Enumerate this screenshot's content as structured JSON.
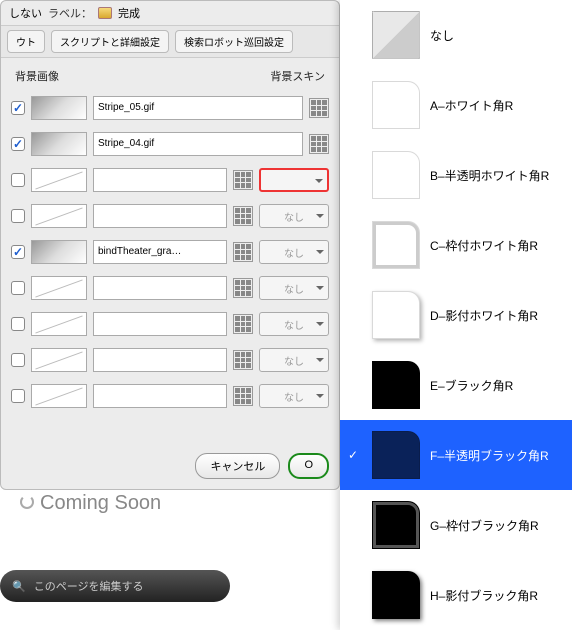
{
  "header": {
    "label_prefix": "ラベル：",
    "done_label": "完成",
    "not_label": "しない"
  },
  "tabs": [
    "ウト",
    "スクリプトと詳細設定",
    "検索ロボット巡回設定"
  ],
  "sections": {
    "left": "背景画像",
    "right": "背景スキン"
  },
  "rows": [
    {
      "checked": true,
      "swatch": "grad",
      "name": "Stripe_05.gif",
      "skin": "",
      "highlight": false
    },
    {
      "checked": true,
      "swatch": "grad",
      "name": "Stripe_04.gif",
      "skin": "",
      "highlight": false
    },
    {
      "checked": false,
      "swatch": "empty",
      "name": "",
      "skin": "",
      "highlight": true
    },
    {
      "checked": false,
      "swatch": "empty",
      "name": "",
      "skin": "なし",
      "highlight": false
    },
    {
      "checked": true,
      "swatch": "grad",
      "name": "bindTheater_gra…",
      "skin": "なし",
      "highlight": false
    },
    {
      "checked": false,
      "swatch": "empty",
      "name": "",
      "skin": "なし",
      "highlight": false
    },
    {
      "checked": false,
      "swatch": "empty",
      "name": "",
      "skin": "なし",
      "highlight": false
    },
    {
      "checked": false,
      "swatch": "empty",
      "name": "",
      "skin": "なし",
      "highlight": false
    },
    {
      "checked": false,
      "swatch": "empty",
      "name": "",
      "skin": "なし",
      "highlight": false
    }
  ],
  "buttons": {
    "cancel": "キャンセル",
    "ok": "O"
  },
  "dropdown": [
    {
      "label": "なし",
      "thumb": "none",
      "selected": false
    },
    {
      "label": "A–ホワイト角R",
      "thumb": "white-r",
      "selected": false
    },
    {
      "label": "B–半透明ホワイト角R",
      "thumb": "white-r trans",
      "selected": false
    },
    {
      "label": "C–枠付ホワイト角R",
      "thumb": "white-r frame",
      "selected": false
    },
    {
      "label": "D–影付ホワイト角R",
      "thumb": "white-r shadow",
      "selected": false
    },
    {
      "label": "E–ブラック角R",
      "thumb": "black-r",
      "selected": false
    },
    {
      "label": "F–半透明ブラック角R",
      "thumb": "black-r trans",
      "selected": true
    },
    {
      "label": "G–枠付ブラック角R",
      "thumb": "black-r frame",
      "selected": false
    },
    {
      "label": "H–影付ブラック角R",
      "thumb": "black-r shadow",
      "selected": false
    }
  ],
  "coming": "Coming Soon",
  "editbar": {
    "mag": "🔍",
    "text": "このページを編集する"
  }
}
